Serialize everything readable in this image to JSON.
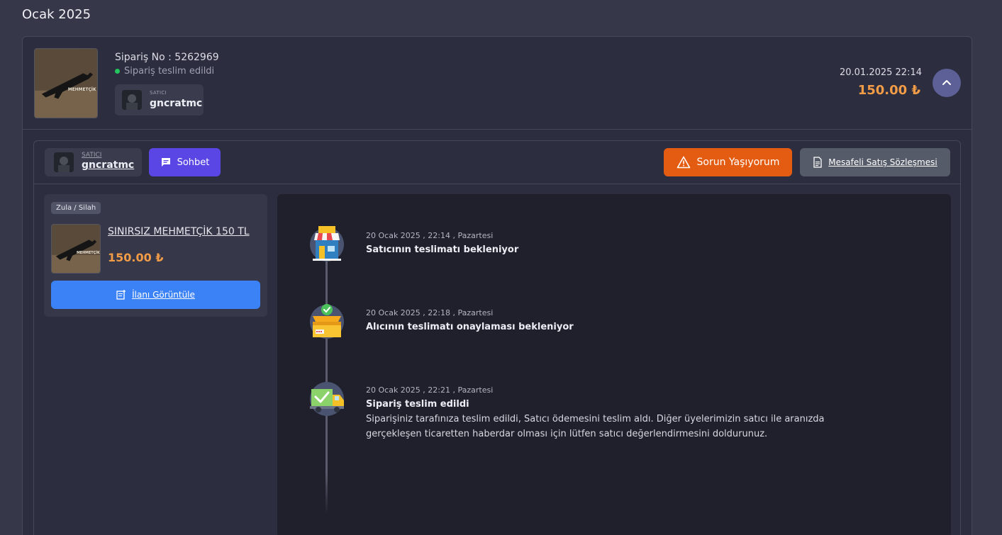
{
  "month_title": "Ocak 2025",
  "order": {
    "order_no": "Sipariş No : 5262969",
    "status": "Sipariş teslim edildi",
    "seller_label": "SATICI",
    "seller_name": "gncratmc",
    "date": "20.01.2025 22:14",
    "price": "150.00 ₺",
    "status_color": "#22c55e",
    "price_color": "#f39c47"
  },
  "detail": {
    "seller_label": "SATICI",
    "seller_name": "gncratmc",
    "chat_label": "Sohbet",
    "problem_label": "Sorun Yaşıyorum",
    "contract_label": "Mesafeli Satış Sözleşmesi",
    "accent_colors": {
      "chat": "#5a46e5",
      "problem": "#e45c11",
      "view": "#3b82f6"
    }
  },
  "product": {
    "category": "Zula / Silah",
    "name": "SINIRSIZ MEHMETÇİK 150 TL",
    "price": "150.00 ₺",
    "view_label": "İlanı Görüntüle"
  },
  "timeline": [
    {
      "date": "20 Ocak 2025 , 22:14 , Pazartesi",
      "title": "Satıcının teslimatı bekleniyor",
      "icon": "store-icon"
    },
    {
      "date": "20 Ocak 2025 , 22:18 , Pazartesi",
      "title": "Alıcının teslimatı onaylaması bekleniyor",
      "icon": "box-check-icon"
    },
    {
      "date": "20 Ocak 2025 , 22:21 , Pazartesi",
      "title": "Sipariş teslim edildi",
      "description": "Siparişiniz tarafınıza teslim edildi, Satıcı ödemesini teslim aldı. Diğer üyelerimizin satıcı ile aranızda gerçekleşen ticaretten haberdar olması için lütfen satıcı değerlendirmesini doldurunuz.",
      "icon": "delivery-truck-icon"
    }
  ]
}
